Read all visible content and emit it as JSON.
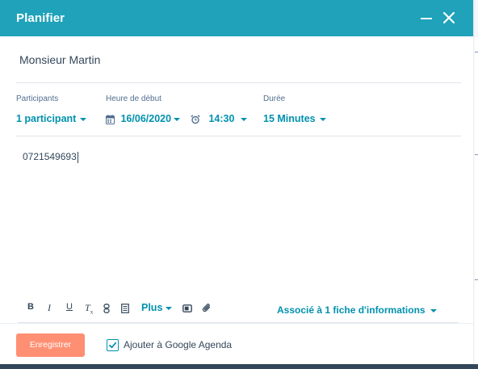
{
  "modal": {
    "title": "Planifier",
    "minimize_icon": "minimize-icon",
    "close_icon": "close-icon"
  },
  "subject": "Monsieur Martin",
  "fields": {
    "participants": {
      "label": "Participants",
      "value": "1 participant"
    },
    "start": {
      "label": "Heure de début",
      "date": "16/06/2020",
      "time": "14:30"
    },
    "duration": {
      "label": "Durée",
      "value": "15 Minutes"
    }
  },
  "body": {
    "text": "0721549693"
  },
  "toolbar": {
    "bold": "B",
    "italic": "I",
    "underline": "U",
    "clear_format": "T",
    "clear_format_sub": "x",
    "more": "Plus",
    "associated": "Associé à 1 fiche d'informations"
  },
  "footer": {
    "save_label": "Enregistrer",
    "google_checkbox_label": "Ajouter à Google Agenda",
    "google_checked": true
  },
  "colors": {
    "header": "#1fa2ba",
    "accent": "#0091ae",
    "save_button": "#ff8f73",
    "text": "#33475b"
  }
}
